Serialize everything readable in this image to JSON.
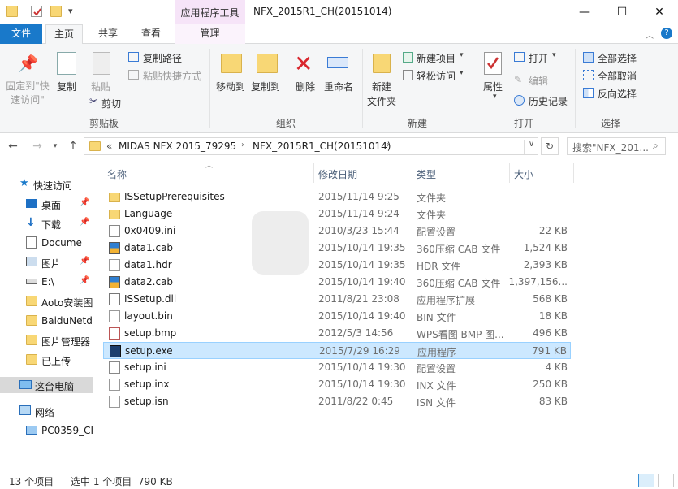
{
  "window": {
    "title": "NFX_2015R1_CH(20151014)",
    "contextual_group": "应用程序工具",
    "controls": {
      "minimize": "—",
      "maximize": "☐",
      "close": "✕"
    }
  },
  "tabs": {
    "file": "文件",
    "home": "主页",
    "share": "共享",
    "view": "查看",
    "manage": "管理"
  },
  "ribbon": {
    "pin_quick_access": "固定到\"快\n速访问\"",
    "copy": "复制",
    "paste": "粘贴",
    "copy_path": "复制路径",
    "paste_shortcut": "粘贴快捷方式",
    "cut": "剪切",
    "group_clipboard": "剪贴板",
    "move_to": "移动到",
    "copy_to": "复制到",
    "delete": "删除",
    "rename": "重命名",
    "group_organize": "组织",
    "new_folder_1": "新建",
    "new_folder_2": "文件夹",
    "new_item": "新建项目",
    "easy_access": "轻松访问",
    "group_new": "新建",
    "properties": "属性",
    "open": "打开",
    "edit": "编辑",
    "history": "历史记录",
    "group_open": "打开",
    "select_all": "全部选择",
    "select_none": "全部取消",
    "invert_select": "反向选择",
    "group_select": "选择"
  },
  "address": {
    "prefix": "«",
    "crumb1": "MIDAS NFX 2015_79295",
    "crumb2": "NFX_2015R1_CH(20151014)",
    "search_placeholder": "搜索\"NFX_201..."
  },
  "nav": {
    "quick_access": "快速访问",
    "desktop": "桌面",
    "downloads": "下载",
    "documents": "Docume",
    "pictures": "图片",
    "edrive": "E:\\",
    "aoto": "Aoto安装图",
    "baidu": "BaiduNetd",
    "picmgr": "图片管理器",
    "uploaded": "已上传",
    "this_pc": "这台电脑",
    "network": "网络",
    "pc0359": "PC0359_CI"
  },
  "columns": {
    "name": "名称",
    "date": "修改日期",
    "type": "类型",
    "size": "大小"
  },
  "files": [
    {
      "name": "ISSetupPrerequisites",
      "date": "2015/11/14 9:25",
      "type": "文件夹",
      "size": "",
      "icon": "folder-icon"
    },
    {
      "name": "Language",
      "date": "2015/11/14 9:24",
      "type": "文件夹",
      "size": "",
      "icon": "folder-icon"
    },
    {
      "name": "0x0409.ini",
      "date": "2010/3/23 15:44",
      "type": "配置设置",
      "size": "22 KB",
      "icon": "settings-file-icon"
    },
    {
      "name": "data1.cab",
      "date": "2015/10/14 19:35",
      "type": "360压缩 CAB 文件",
      "size": "1,524 KB",
      "icon": "cab-archive-icon"
    },
    {
      "name": "data1.hdr",
      "date": "2015/10/14 19:35",
      "type": "HDR 文件",
      "size": "2,393 KB",
      "icon": "file-icon"
    },
    {
      "name": "data2.cab",
      "date": "2015/10/14 19:40",
      "type": "360压缩 CAB 文件",
      "size": "1,397,156...",
      "icon": "cab-archive-icon"
    },
    {
      "name": "ISSetup.dll",
      "date": "2011/8/21 23:08",
      "type": "应用程序扩展",
      "size": "568 KB",
      "icon": "dll-file-icon"
    },
    {
      "name": "layout.bin",
      "date": "2015/10/14 19:40",
      "type": "BIN 文件",
      "size": "18 KB",
      "icon": "file-icon"
    },
    {
      "name": "setup.bmp",
      "date": "2012/5/3 14:56",
      "type": "WPS看图 BMP 图...",
      "size": "496 KB",
      "icon": "bmp-image-icon"
    },
    {
      "name": "setup.exe",
      "date": "2015/7/29 16:29",
      "type": "应用程序",
      "size": "791 KB",
      "icon": "exe-app-icon"
    },
    {
      "name": "setup.ini",
      "date": "2015/10/14 19:30",
      "type": "配置设置",
      "size": "4 KB",
      "icon": "settings-file-icon"
    },
    {
      "name": "setup.inx",
      "date": "2015/10/14 19:30",
      "type": "INX 文件",
      "size": "250 KB",
      "icon": "file-icon"
    },
    {
      "name": "setup.isn",
      "date": "2011/8/22 0:45",
      "type": "ISN 文件",
      "size": "83 KB",
      "icon": "file-icon"
    }
  ],
  "selected_row": 9,
  "status": {
    "count": "13 个项目",
    "selection": "选中 1 个项目  790 KB"
  },
  "colors": {
    "accent": "#1979ca",
    "selection": "#cce8ff",
    "selection_border": "#99d1ff"
  }
}
